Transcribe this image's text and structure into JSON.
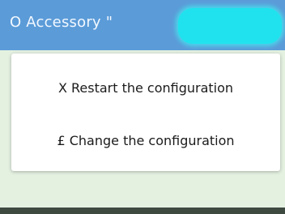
{
  "title_bar": {
    "title": "O Accessory \""
  },
  "menu": {
    "items": [
      {
        "label": "X Restart the configuration"
      },
      {
        "label": "£ Change the configuration"
      }
    ]
  },
  "colors": {
    "title_bar": "#5b9bd8",
    "highlight": "#20e2ee",
    "backdrop": "#e4f1e1"
  }
}
